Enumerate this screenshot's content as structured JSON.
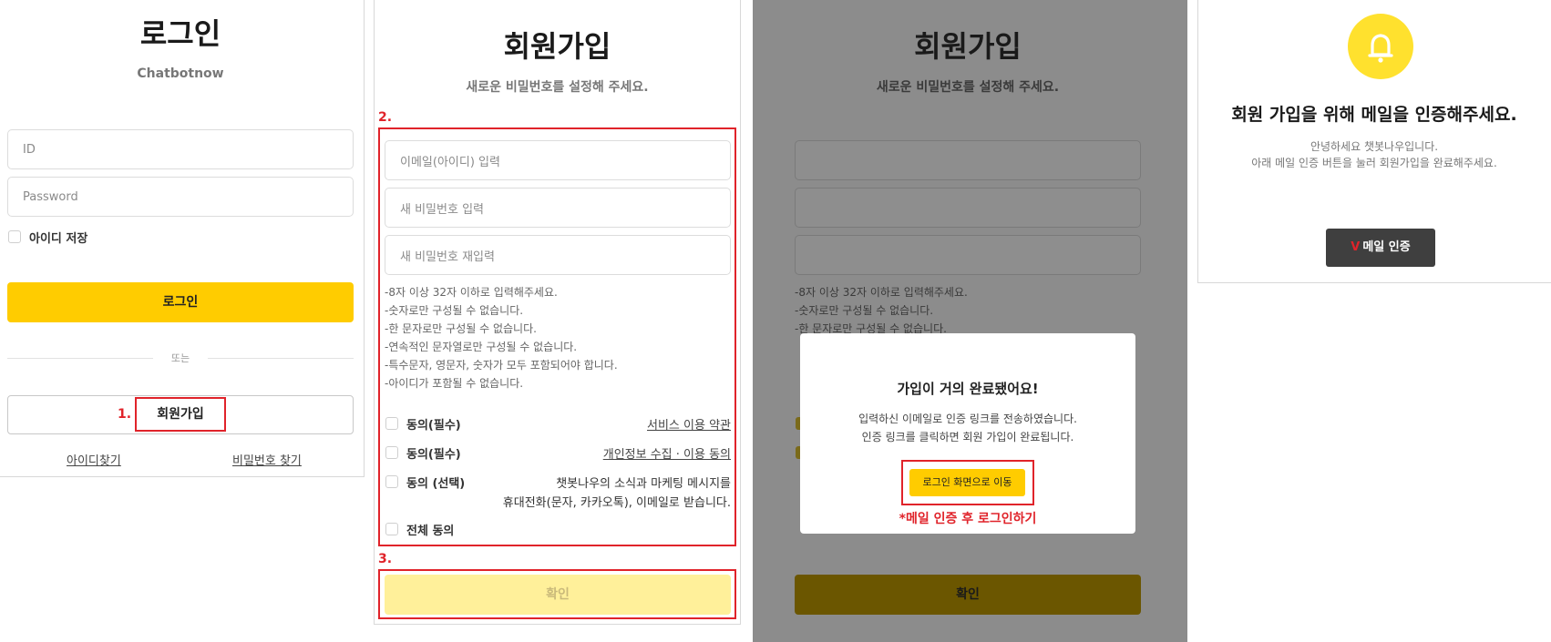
{
  "login": {
    "title": "로그인",
    "subtitle": "Chatbotnow",
    "id_placeholder": "ID",
    "password_placeholder": "Password",
    "remember_label": "아이디 저장",
    "login_button": "로그인",
    "or_label": "또는",
    "signup_button": "회원가입",
    "find_id": "아이디찾기",
    "find_password": "비밀번호 찾기",
    "step1": "1."
  },
  "signup": {
    "title": "회원가입",
    "subtitle": "새로운 비밀번호를 설정해 주세요.",
    "step2": "2.",
    "step3": "3.",
    "email_placeholder": "이메일(아이디) 입력",
    "password_placeholder": "새 비밀번호 입력",
    "password_confirm_placeholder": "새 비밀번호 재입력",
    "rules": [
      "-8자 이상 32자 이하로 입력해주세요.",
      "-숫자로만 구성될 수 없습니다.",
      "-한 문자로만 구성될 수 없습니다.",
      "-연속적인 문자열로만 구성될 수 없습니다.",
      "-특수문자, 영문자, 숫자가 모두 포함되어야 합니다.",
      "-아이디가 포함될 수 없습니다."
    ],
    "agree1_label": "동의(필수)",
    "agree1_link": "서비스 이용 약관",
    "agree2_label": "동의(필수)",
    "agree2_link": "개인정보 수집 · 이용 동의",
    "agree3_label": "동의 (선택)",
    "agree3_desc_line1": "챗봇나우의 소식과 마케팅 메시지를",
    "agree3_desc_line2": "휴대전화(문자, 카카오톡), 이메일로 받습니다.",
    "agree_all_label": "전체 동의",
    "confirm_button": "확인"
  },
  "modal_screen": {
    "title": "회원가입",
    "subtitle": "새로운 비밀번호를 설정해 주세요.",
    "rules_visible": [
      "-8자 이상 32자 이하로 입력해주세요.",
      "-숫자로만 구성될 수 없습니다.",
      "-한 문자로만 구성될 수 없습니다."
    ],
    "confirm_button": "확인",
    "modal": {
      "title": "가입이 거의 완료됐어요!",
      "line1": "입력하신 이메일로 인증 링크를 전송하였습니다.",
      "line2": "인증 링크를 클릭하면 회원 가입이 완료됩니다.",
      "button": "로그인 화면으로 이동",
      "note": "*메일 인증 후 로그인하기"
    }
  },
  "email_verify": {
    "icon": "bell-icon",
    "title": "회원 가입을 위해 메일을 인증해주세요.",
    "line1": "안녕하세요 챗봇나우입니다.",
    "line2": "아래 메일 인증 버튼을 눌러 회원가입을 완료해주세요.",
    "button_mark": "V",
    "button": "메일 인증"
  },
  "colors": {
    "yellow": "#ffcc00",
    "pale_yellow": "#fff09a",
    "red_annotation": "#e0232a",
    "dark_button": "#3f3f3f",
    "overlay": "#8c8c8c"
  }
}
